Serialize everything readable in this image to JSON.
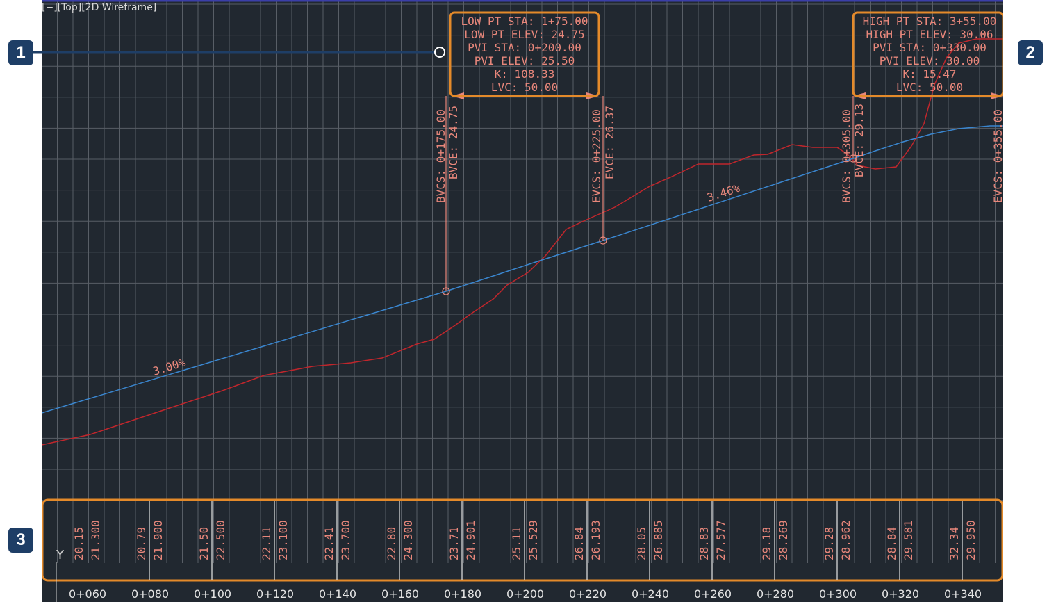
{
  "viewport": {
    "label": "[−][Top][2D Wireframe]",
    "colors": {
      "background": "#212830",
      "grid": "#6b7078",
      "eg": "#c0262c",
      "fg": "#3a86cf",
      "annotation": "#e8877b",
      "highlight": "#e48a2a",
      "callout": "#1e3e66"
    }
  },
  "callouts": [
    "1",
    "2",
    "3"
  ],
  "low_point_box": [
    "LOW  PT  STA:  1+75.00",
    "LOW  PT  ELEV:  24.75",
    "PVI  STA: 0+200.00",
    "PVI  ELEV: 25.50",
    "K: 108.33",
    "LVC: 50.00"
  ],
  "high_point_box": [
    "HIGH  PT  STA:  3+55.00",
    "HIGH  PT  ELEV:  30.06",
    "PVI  STA: 0+330.00",
    "PVI  ELEV: 30.00",
    "K: 15.47",
    "LVC: 50.00"
  ],
  "curve_labels": {
    "bvcs_1": "BVCS:  0+175.00",
    "bvce_1": "BVCE:  24.75",
    "evcs_1": "EVCS:  0+225.00",
    "evce_1": "EVCE:  26.37",
    "bvcs_2": "BVCS:  0+305.00",
    "bvce_2": "BVCE:  29.13",
    "evcs_2": "EVCS:  0+355.00"
  },
  "grade_labels": {
    "grade_1": "3.00%",
    "grade_2": "3.46%"
  },
  "elevation_band": [
    {
      "eg": "20.15",
      "fg": "21.300"
    },
    {
      "eg": "20.79",
      "fg": "21.900"
    },
    {
      "eg": "21.50",
      "fg": "22.500"
    },
    {
      "eg": "22.11",
      "fg": "23.100"
    },
    {
      "eg": "22.41",
      "fg": "23.700"
    },
    {
      "eg": "22.80",
      "fg": "24.300"
    },
    {
      "eg": "23.71",
      "fg": "24.901"
    },
    {
      "eg": "25.11",
      "fg": "25.529"
    },
    {
      "eg": "26.84",
      "fg": "26.193"
    },
    {
      "eg": "28.05",
      "fg": "26.885"
    },
    {
      "eg": "28.83",
      "fg": "27.577"
    },
    {
      "eg": "29.18",
      "fg": "28.269"
    },
    {
      "eg": "29.28",
      "fg": "28.962"
    },
    {
      "eg": "28.84",
      "fg": "29.581"
    },
    {
      "eg": "32.34",
      "fg": "29.950"
    }
  ],
  "stations": [
    "0+060",
    "0+080",
    "0+100",
    "0+120",
    "0+140",
    "0+160",
    "0+180",
    "0+200",
    "0+220",
    "0+240",
    "0+260",
    "0+280",
    "0+300",
    "0+320",
    "0+340"
  ],
  "ucs_axis_label": "Y"
}
